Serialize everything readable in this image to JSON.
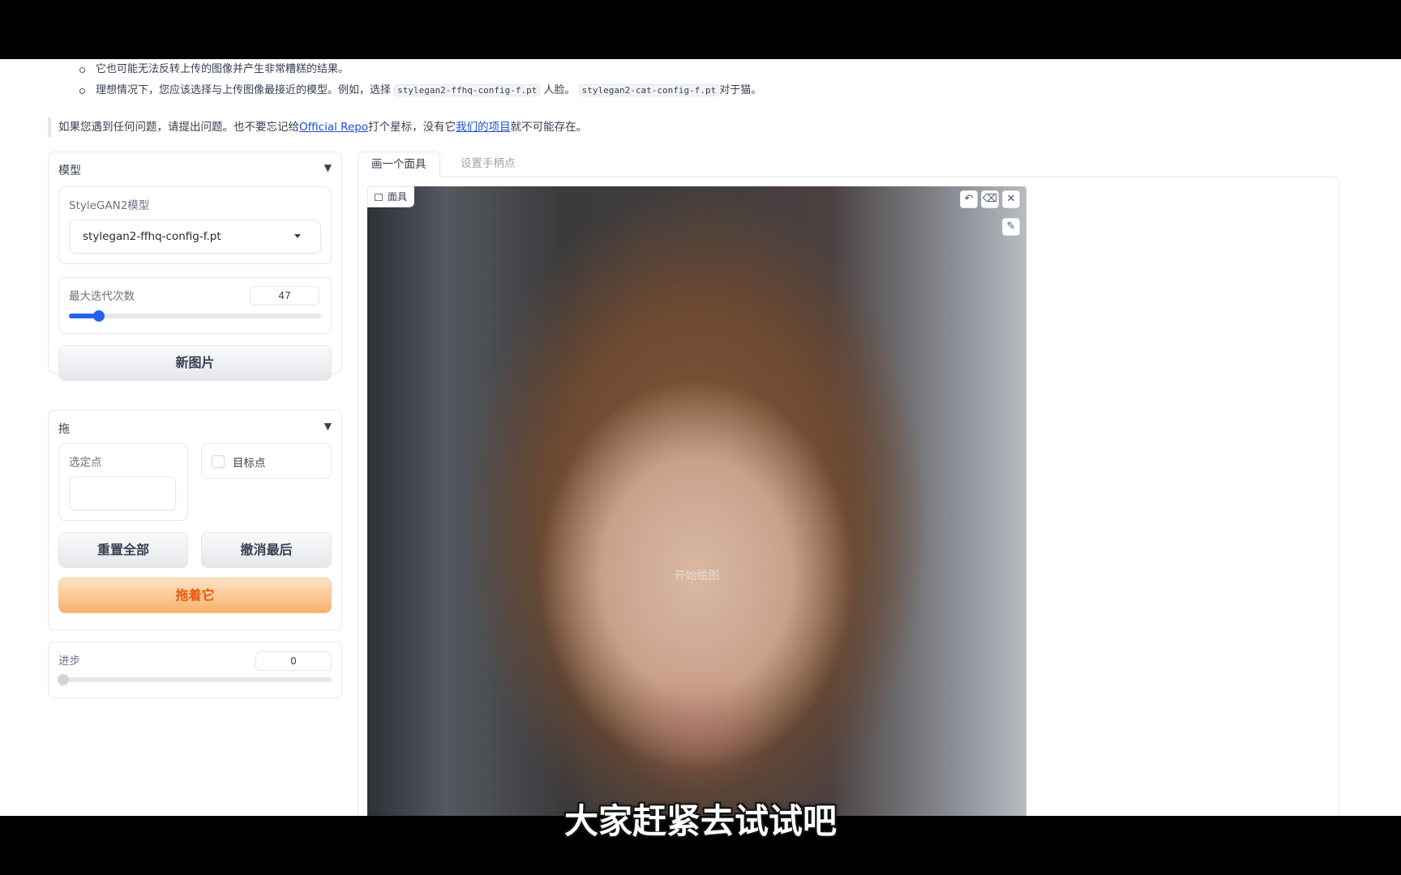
{
  "intro": {
    "bullets": [
      {
        "text": "它也可能无法反转上传的图像并产生非常糟糕的结果。"
      },
      {
        "pre": "理想情况下，您应该选择与上传图像最接近的模型。例如，选择",
        "code1": "stylegan2-ffhq-config-f.pt",
        "mid": "人脸。",
        "code2": "stylegan2-cat-config-f.pt",
        "post": "对于猫。"
      }
    ],
    "note": {
      "pre": "如果您遇到任何问题，请提出问题。也不要忘记给",
      "link1": "Official Repo",
      "mid": "打个星标，没有它",
      "link2": "我们的项目",
      "post": "就不可能存在。"
    }
  },
  "model_panel": {
    "title": "模型",
    "toggle": "▼",
    "select_label": "StyleGAN2模型",
    "select_value": "stylegan2-ffhq-config-f.pt",
    "iter_label": "最大迭代次数",
    "iter_value": "47",
    "iter_fraction": 0.12,
    "new_image_button": "新图片"
  },
  "drag_panel": {
    "title": "拖",
    "toggle": "▼",
    "selected_points_label": "选定点",
    "selected_points_value": "",
    "target_checkbox_label": "目标点",
    "target_checked": false,
    "reset_all_button": "重置全部",
    "undo_last_button": "撤消最后",
    "drag_button": "拖着它"
  },
  "progress_panel": {
    "label": "进步",
    "value": "0",
    "fraction": 0
  },
  "tabs": [
    {
      "label": "画一个面具",
      "active": true
    },
    {
      "label": "设置手柄点",
      "active": false
    }
  ],
  "canvas": {
    "label": "面具",
    "hint": "开始绘图",
    "tools": {
      "undo": "↶",
      "erase": "⌫",
      "close": "✕",
      "brush": "✎"
    }
  },
  "subtitle": "大家赶紧去试试吧",
  "colors": {
    "accent": "#2563eb",
    "primary_button_text": "#ea580c",
    "link": "#1d4ed8"
  }
}
